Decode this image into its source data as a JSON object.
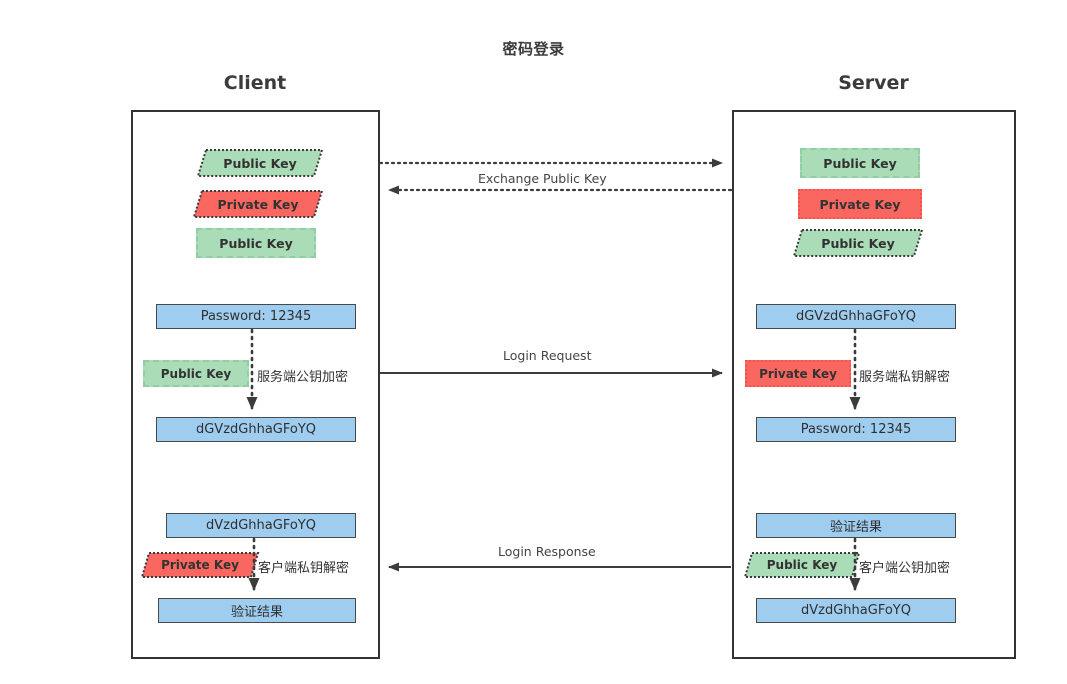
{
  "title": "密码登录",
  "lanes": {
    "client": {
      "header": "Client"
    },
    "server": {
      "header": "Server"
    }
  },
  "colors": {
    "green_fill": "#a9dcb7",
    "green_border": "#8fcfa1",
    "red_fill": "#fa6760",
    "red_border": "#f4514a",
    "blue_fill": "#9fcdf0",
    "blue_border": "#4a4a4a",
    "line": "#3c3c3c",
    "text": "#333333"
  },
  "client": {
    "keys": [
      {
        "label": "Public Key",
        "shape": "parallelogram",
        "color": "green",
        "border": "dotted"
      },
      {
        "label": "Private Key",
        "shape": "parallelogram",
        "color": "red",
        "border": "dotted"
      },
      {
        "label": "Public Key",
        "shape": "rect",
        "color": "green",
        "border": "dashed"
      }
    ],
    "encrypt": {
      "input": "Password: 12345",
      "key": "Public Key",
      "key_shape": "rect",
      "key_color": "green",
      "operation": "服务端公钥加密",
      "output": "dGVzdGhhaGFoYQ"
    },
    "decrypt": {
      "input": "dVzdGhhaGFoYQ",
      "key": "Private Key",
      "key_shape": "parallelogram",
      "key_color": "red",
      "operation": "客户端私钥解密",
      "output": "验证结果"
    }
  },
  "server": {
    "keys": [
      {
        "label": "Public Key",
        "shape": "rect",
        "color": "green",
        "border": "dashed"
      },
      {
        "label": "Private Key",
        "shape": "rect",
        "color": "red",
        "border": "dotted"
      },
      {
        "label": "Public Key",
        "shape": "parallelogram",
        "color": "green",
        "border": "dotted"
      }
    ],
    "decrypt": {
      "input": "dGVzdGhhaGFoYQ",
      "key": "Private Key",
      "key_shape": "rect",
      "key_color": "red",
      "operation": "服务端私钥解密",
      "output": "Password: 12345"
    },
    "encrypt": {
      "input": "验证结果",
      "key": "Public Key",
      "key_shape": "parallelogram",
      "key_color": "green",
      "operation": "客户端公钥加密",
      "output": "dVzdGhhaGFoYQ"
    }
  },
  "flows": [
    {
      "label": "Exchange Public Key",
      "style": "dotted",
      "direction": "both"
    },
    {
      "label": "Login Request",
      "style": "solid",
      "direction": "right"
    },
    {
      "label": "Login Response",
      "style": "solid",
      "direction": "left"
    }
  ],
  "flow_labels": {
    "exchange": "Exchange Public Key",
    "login_request": "Login Request",
    "login_response": "Login Response"
  }
}
